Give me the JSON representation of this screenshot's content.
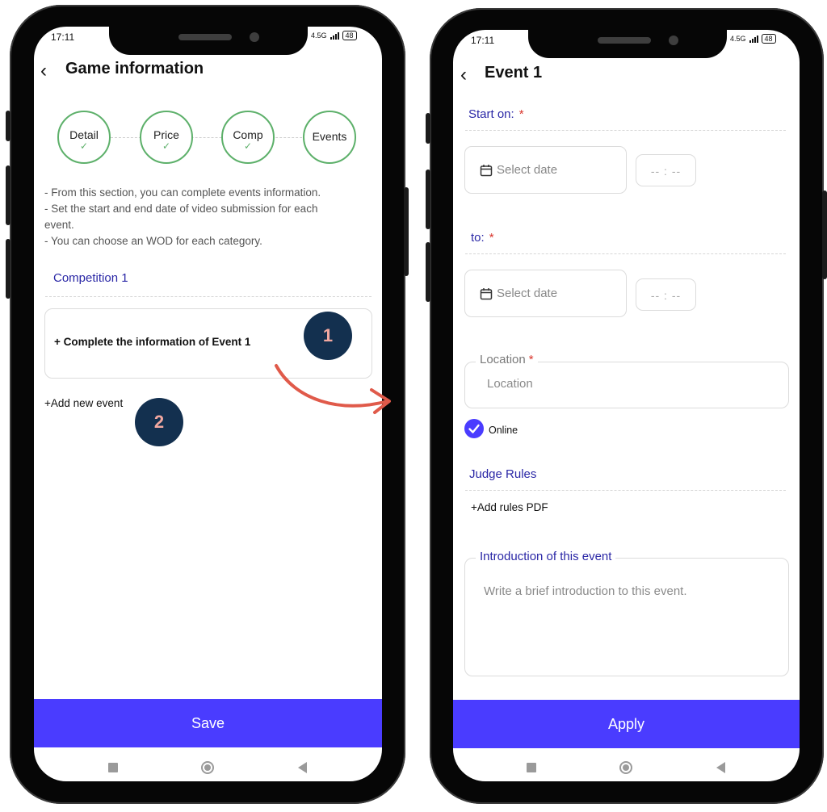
{
  "status": {
    "time": "17:11",
    "network": "4.5G",
    "battery": "48"
  },
  "left": {
    "title": "Game information",
    "steps": [
      {
        "label": "Detail",
        "done": true
      },
      {
        "label": "Price",
        "done": true
      },
      {
        "label": "Comp",
        "done": true
      },
      {
        "label": "Events",
        "done": false
      }
    ],
    "intro_lines": [
      "- From this section, you can complete events information.",
      "- Set the start and end date of video submission for each",
      "event.",
      "- You can choose an WOD for each category."
    ],
    "competition_label": "Competition 1",
    "event_card_text": "+ Complete the information of Event  1",
    "badge_1": "1",
    "add_event_label": "+Add new event",
    "badge_2": "2",
    "save_label": "Save"
  },
  "right": {
    "title": "Event 1",
    "start_label": "Start on:",
    "to_label": "to:",
    "required_mark": "*",
    "date_placeholder": "Select date",
    "time_placeholder": "--  :  --",
    "location_label": "Location",
    "location_placeholder": "Location",
    "online_label": "Online",
    "online_checked": true,
    "judge_rules_label": "Judge Rules",
    "add_rules_label": "+Add rules PDF",
    "intro_label": "Introduction of this event",
    "intro_placeholder": "Write a brief introduction to this event.",
    "apply_label": "Apply"
  },
  "colors": {
    "primary": "#4a3cff",
    "step_done": "#5db06a",
    "section": "#2a27a6",
    "badge": "#13304f",
    "arrow": "#e05a4a",
    "required": "#d9342b"
  }
}
